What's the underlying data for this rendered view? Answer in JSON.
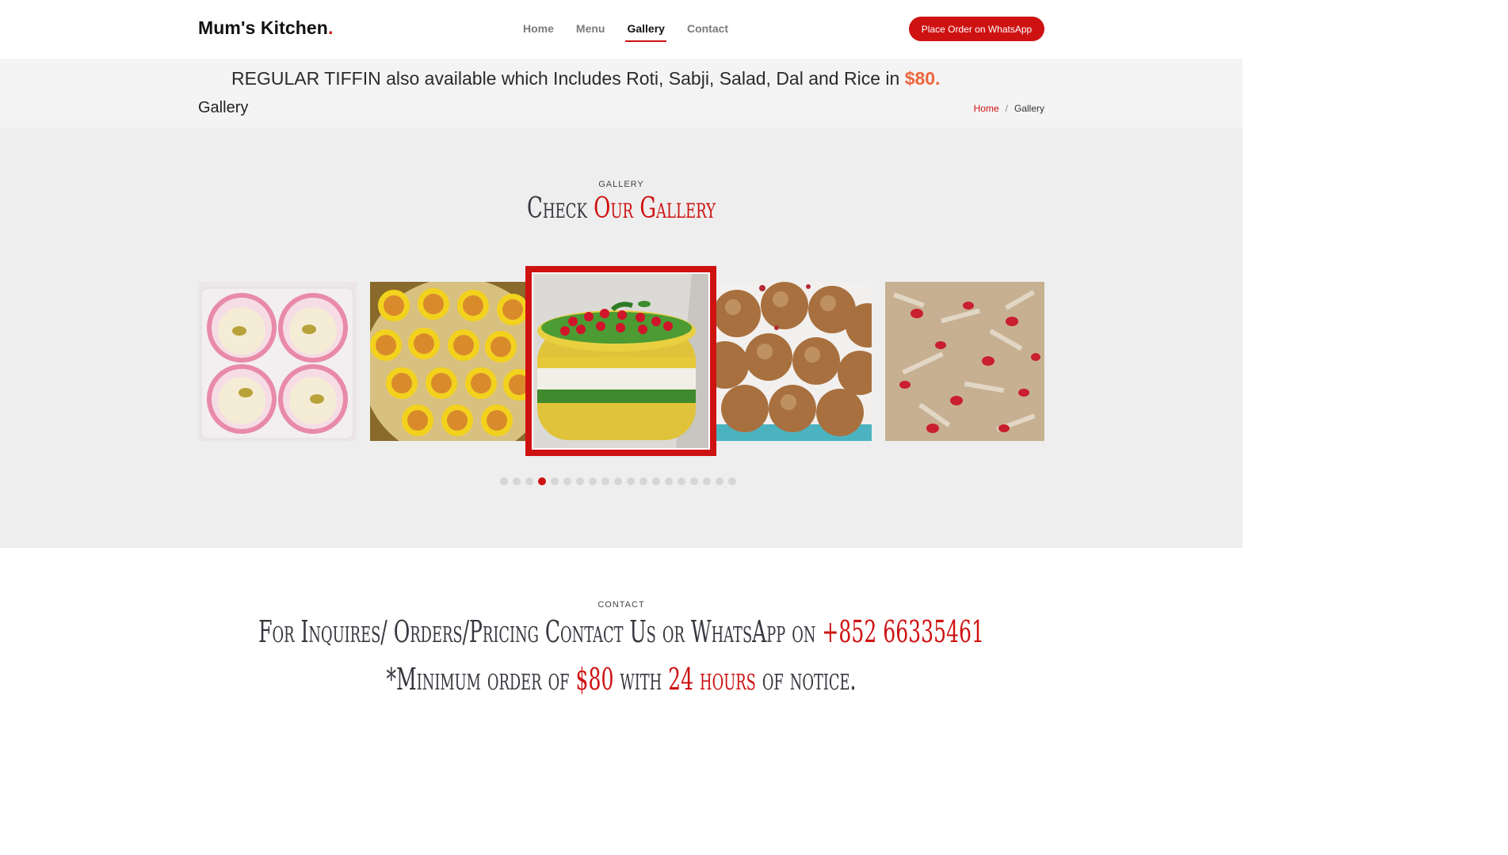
{
  "header": {
    "logo": "Mum's Kitchen",
    "logo_dot": ".",
    "nav": [
      "Home",
      "Menu",
      "Gallery",
      "Contact"
    ],
    "active_nav": "Gallery",
    "order_button": "Place Order on WhatsApp"
  },
  "banner": {
    "promo_text": "REGULAR TIFFIN also available which Includes Roti, Sabji, Salad, Dal and Rice in",
    "promo_price": "$80.",
    "page_title": "Gallery",
    "breadcrumb_home": "Home",
    "breadcrumb_sep": "/",
    "breadcrumb_current": "Gallery"
  },
  "gallery": {
    "label": "GALLERY",
    "title_plain": "Check",
    "title_red": "Our Gallery",
    "dots_count": 19,
    "active_dot": 4,
    "images": [
      "pink-cup-sweets-image",
      "yellow-cup-laddoos-image",
      "layered-dhokla-cake-image",
      "sesame-laddoos-image",
      "rose-petal-sweet-image"
    ]
  },
  "contact": {
    "label": "CONTACT",
    "line1_plain": "For Inquires/ Orders/Pricing Contact Us or WhatsApp on",
    "line1_red": "+852 66335461",
    "line2_a": "*Minimum order of",
    "line2_price": "$80",
    "line2_b": "with",
    "line2_hours": "24 hours",
    "line2_c": "of notice."
  },
  "colors": {
    "accent": "#ce1212",
    "price": "#f0663c",
    "section_bg": "#eeeeee"
  }
}
